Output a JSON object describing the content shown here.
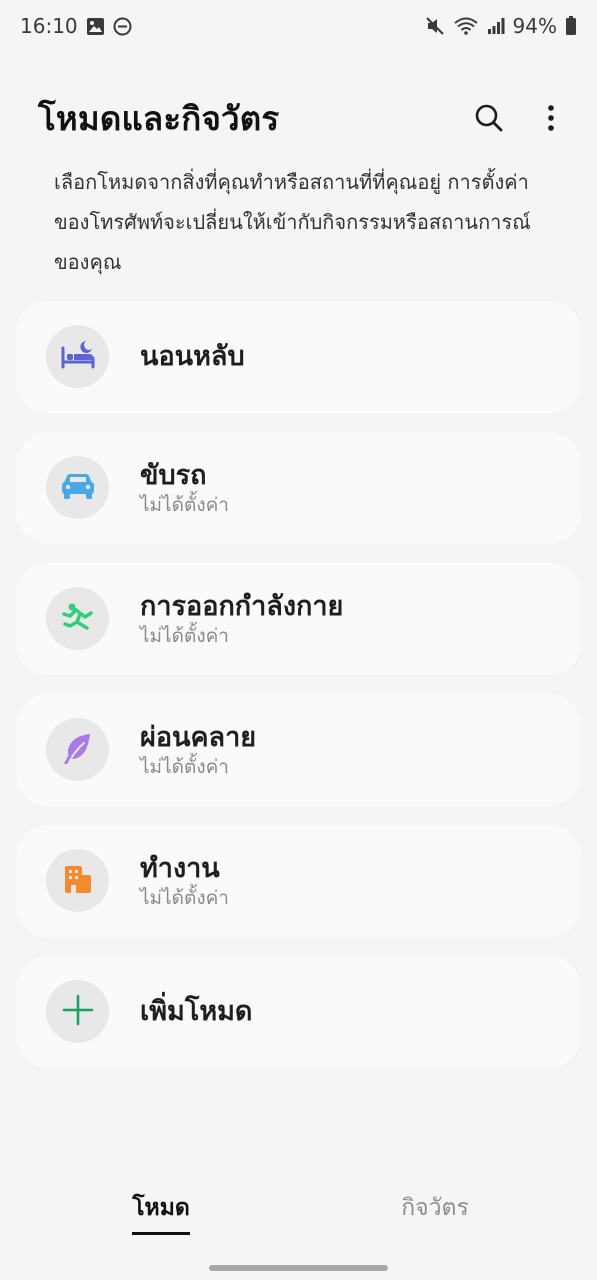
{
  "status_bar": {
    "time": "16:10",
    "battery": "94%",
    "icons": [
      "gallery-icon",
      "dnd-icon",
      "mute-icon",
      "wifi-icon",
      "signal-icon",
      "battery-icon"
    ]
  },
  "header": {
    "title": "โหมดและกิจวัตร",
    "actions": [
      "search-icon",
      "more-options-icon"
    ]
  },
  "description": "เลือกโหมดจากสิ่งที่คุณทำหรือสถานที่ที่คุณอยู่ การตั้งค่าของโทรศัพท์จะเปลี่ยนให้เข้ากับกิจกรรมหรือสถานการณ์ของคุณ",
  "modes": [
    {
      "title": "นอนหลับ",
      "subtitle": "",
      "icon": "bed-moon-icon",
      "color": "#5b63d6"
    },
    {
      "title": "ขับรถ",
      "subtitle": "ไม่ได้ตั้งค่า",
      "icon": "car-icon",
      "color": "#4aa8e8"
    },
    {
      "title": "การออกกำลังกาย",
      "subtitle": "ไม่ได้ตั้งค่า",
      "icon": "running-icon",
      "color": "#2fcf7a"
    },
    {
      "title": "ผ่อนคลาย",
      "subtitle": "ไม่ได้ตั้งค่า",
      "icon": "leaf-icon",
      "color": "#a77be6"
    },
    {
      "title": "ทำงาน",
      "subtitle": "ไม่ได้ตั้งค่า",
      "icon": "building-icon",
      "color": "#f28b30"
    }
  ],
  "add_mode": {
    "label": "เพิ่มโหมด",
    "icon": "plus-icon",
    "color": "#1aa260"
  },
  "tabs": [
    {
      "label": "โหมด",
      "active": true
    },
    {
      "label": "กิจวัตร",
      "active": false
    }
  ]
}
